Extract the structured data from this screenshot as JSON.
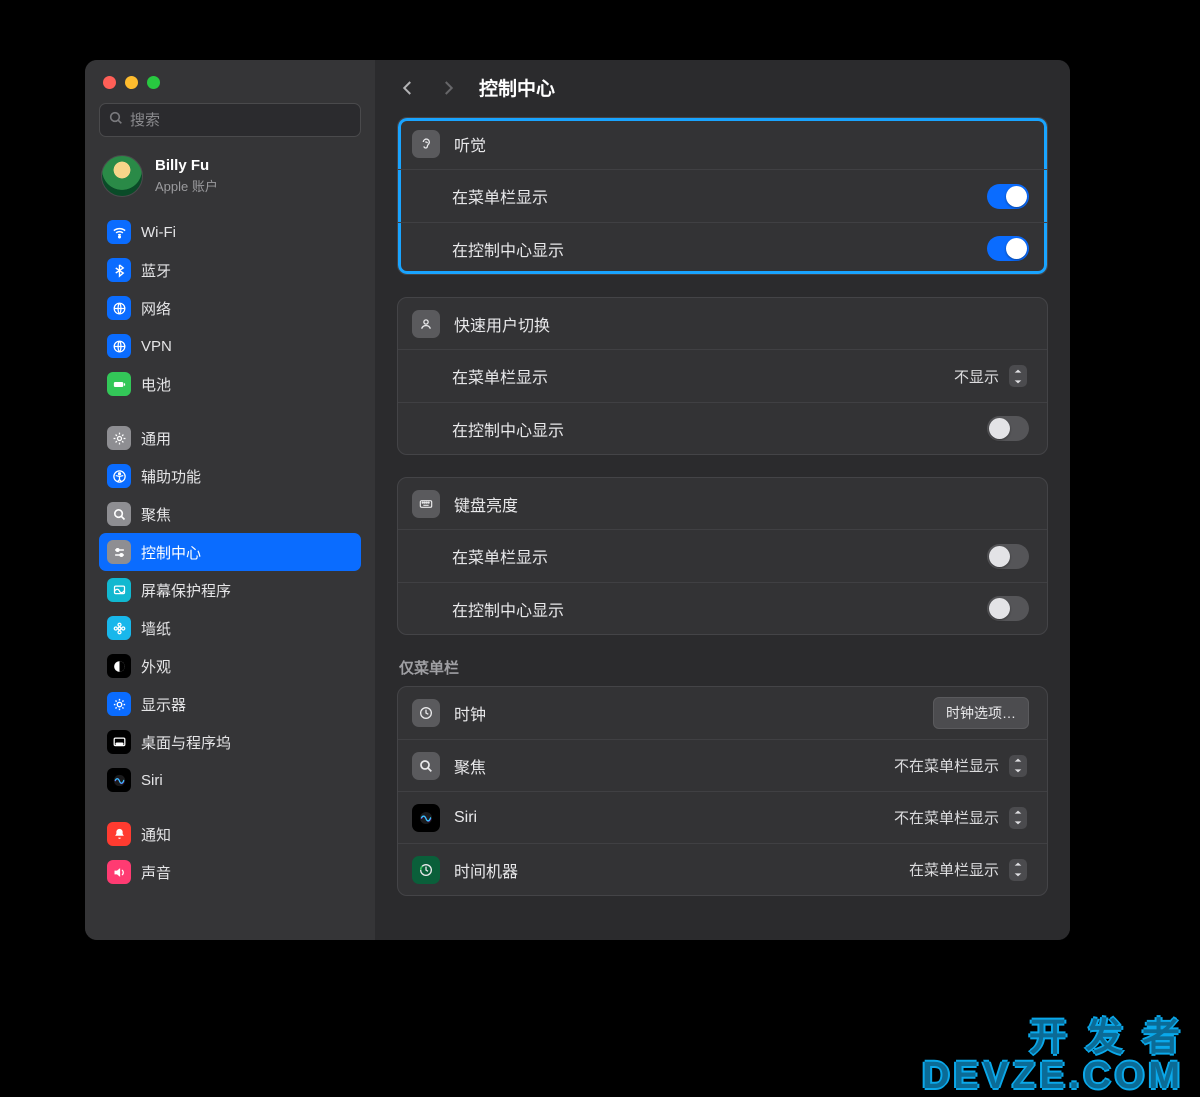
{
  "search": {
    "placeholder": "搜索"
  },
  "account": {
    "name": "Billy Fu",
    "sub": "Apple 账户"
  },
  "header": {
    "title": "控制中心"
  },
  "sidebar": {
    "items": [
      {
        "label": "Wi-Fi",
        "icon": "wifi-icon",
        "bg": "#0a6cff"
      },
      {
        "label": "蓝牙",
        "icon": "bluetooth-icon",
        "bg": "#0a6cff"
      },
      {
        "label": "网络",
        "icon": "globe-icon",
        "bg": "#0a6cff"
      },
      {
        "label": "VPN",
        "icon": "globe-icon",
        "bg": "#0a6cff"
      },
      {
        "label": "电池",
        "icon": "battery-icon",
        "bg": "#33c758"
      },
      {
        "_gap": true
      },
      {
        "label": "通用",
        "icon": "gear-icon",
        "bg": "#8e8e92"
      },
      {
        "label": "辅助功能",
        "icon": "accessibility-icon",
        "bg": "#0a6cff"
      },
      {
        "label": "聚焦",
        "icon": "search-icon",
        "bg": "#8e8e92"
      },
      {
        "label": "控制中心",
        "icon": "sliders-icon",
        "bg": "#8e8e92",
        "selected": true
      },
      {
        "label": "屏幕保护程序",
        "icon": "screensaver-icon",
        "bg": "#11b8d0"
      },
      {
        "label": "墙纸",
        "icon": "flower-icon",
        "bg": "#18b7eb"
      },
      {
        "label": "外观",
        "icon": "contrast-icon",
        "bg": "#000"
      },
      {
        "label": "显示器",
        "icon": "sun-icon",
        "bg": "#0a6cff"
      },
      {
        "label": "桌面与程序坞",
        "icon": "dock-icon",
        "bg": "#000"
      },
      {
        "label": "Siri",
        "icon": "siri-icon",
        "bg": "#000",
        "siri": true
      },
      {
        "_gap": true
      },
      {
        "label": "通知",
        "icon": "bell-icon",
        "bg": "#ff3b30"
      },
      {
        "label": "声音",
        "icon": "speaker-icon",
        "bg": "#ff3b72"
      }
    ]
  },
  "groups": [
    {
      "icon": "ear-icon",
      "title": "听觉",
      "highlight": true,
      "rows": [
        {
          "label": "在菜单栏显示",
          "kind": "toggle",
          "on": true
        },
        {
          "label": "在控制中心显示",
          "kind": "toggle",
          "on": true
        }
      ]
    },
    {
      "icon": "user-icon",
      "title": "快速用户切换",
      "rows": [
        {
          "label": "在菜单栏显示",
          "kind": "select",
          "value": "不显示"
        },
        {
          "label": "在控制中心显示",
          "kind": "toggle",
          "on": false
        }
      ]
    },
    {
      "icon": "keyboard-icon",
      "title": "键盘亮度",
      "rows": [
        {
          "label": "在菜单栏显示",
          "kind": "toggle",
          "on": false
        },
        {
          "label": "在控制中心显示",
          "kind": "toggle",
          "on": false
        }
      ]
    }
  ],
  "menuOnly": {
    "heading": "仅菜单栏",
    "rows": [
      {
        "icon": "clock-icon",
        "title": "时钟",
        "kind": "button",
        "value": "时钟选项…"
      },
      {
        "icon": "search-icon",
        "title": "聚焦",
        "kind": "popup",
        "value": "不在菜单栏显示"
      },
      {
        "icon": "siri-icon",
        "title": "Siri",
        "kind": "popup",
        "value": "不在菜单栏显示",
        "siri": true
      },
      {
        "icon": "tm-icon",
        "title": "时间机器",
        "kind": "popup",
        "value": "在菜单栏显示"
      }
    ]
  },
  "watermark": {
    "line1": "开 发 者",
    "line2": "DEVZE.COM"
  }
}
